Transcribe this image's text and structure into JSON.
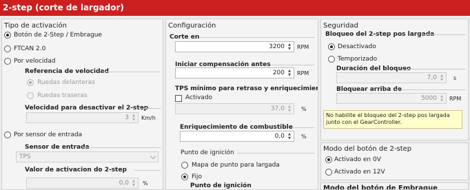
{
  "window": {
    "title": "2-step (corte de largador)"
  },
  "activation": {
    "title": "Tipo de activación",
    "options": [
      {
        "label": "Botón de 2-Step / Embrague",
        "selected": true
      },
      {
        "label": "FTCAN 2.0",
        "selected": false
      },
      {
        "label": "Por velocidad",
        "selected": false
      },
      {
        "label": "Por sensor de entrada",
        "selected": false
      }
    ],
    "speed_ref": {
      "title": "Referencia de velocidad",
      "options": [
        {
          "label": "Ruedas delanteras",
          "selected": true
        },
        {
          "label": "Ruedas traseras",
          "selected": false
        }
      ]
    },
    "speed_disable": {
      "label": "Velocidad para desactivar el 2-step",
      "value": "3",
      "unit": "Km/h"
    },
    "input_sensor": {
      "label": "Sensor de entrada",
      "value": "TPS"
    },
    "activation_value": {
      "label": "Valor de activacion do 2-step",
      "value": "0,0",
      "unit": "%"
    }
  },
  "config": {
    "title": "Configuración",
    "cut_rpm": {
      "label": "Corte en",
      "value": "3200",
      "unit": "RPM"
    },
    "comp_start": {
      "label": "Iniciar compensación antes",
      "value": "200",
      "unit": "RPM"
    },
    "tps_min": {
      "label": "TPS mínimo para retraso y enriquecimiento",
      "checkbox": "Activado",
      "value": "37,0",
      "unit": "%"
    },
    "fuel_enrich": {
      "label": "Enriquecimiento de combustible",
      "value": "0,0",
      "unit": "%"
    },
    "ignition": {
      "label": "Punto de ignición",
      "options": [
        {
          "label": "Mapa de punto para largada",
          "selected": false
        },
        {
          "label": "Fijo",
          "selected": true
        }
      ],
      "sub_label": "Punto de ignición"
    }
  },
  "security": {
    "title": "Seguridad",
    "lock_title": "Bloqueo del 2-step pos largada",
    "options": [
      {
        "label": "Desactivado",
        "selected": true
      },
      {
        "label": "Temporizado",
        "selected": false
      }
    ],
    "lock_duration": {
      "label": "Duración del bloqueo",
      "value": "7,0",
      "unit": "s"
    },
    "lock_above": {
      "label": "Bloquear arriba de",
      "value": "5000",
      "unit": "RPM"
    },
    "warning": "No habilite el bloqueo del 2-step pos largada junto con el GearController."
  },
  "button_mode": {
    "title": "Modo del botón de 2-step",
    "options": [
      {
        "label": "Activado en 0V",
        "selected": true
      },
      {
        "label": "Activado en 12V",
        "selected": false
      }
    ],
    "next_title": "Modo del botón de Embrague"
  },
  "colors": {
    "title_bar": "#cc1f1f",
    "panel_bg": "#f4f4f4",
    "warning_bg": "#ffffcc"
  }
}
